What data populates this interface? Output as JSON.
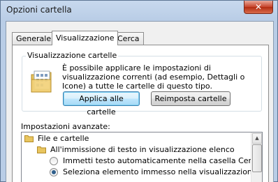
{
  "window": {
    "title": "Opzioni cartella",
    "close_label": "✕"
  },
  "tabs": [
    {
      "label": "Generale",
      "active": false
    },
    {
      "label": "Visualizzazione",
      "active": true
    },
    {
      "label": "Cerca",
      "active": false
    }
  ],
  "folder_view": {
    "group_title": "Visualizzazione cartelle",
    "description": "È possibile applicare le impostazioni di visualizzazione correnti (ad esempio, Dettagli o Icone) a tutte le cartelle di questo tipo.",
    "apply_button": "Applica alle cartelle",
    "reset_button": "Reimposta cartelle"
  },
  "advanced": {
    "label": "Impostazioni avanzate:",
    "items": [
      {
        "label": "File e cartelle",
        "type": "folder",
        "level": 0
      },
      {
        "label": "All'immissione di testo in visualizzazione elenco",
        "type": "folder",
        "level": 1
      },
      {
        "label": "Immetti testo automaticamente nella casella Cerca",
        "type": "radio",
        "checked": false,
        "level": 2
      },
      {
        "label": "Seleziona elemento immesso nella visualizzazione",
        "type": "radio",
        "checked": true,
        "level": 2
      }
    ]
  },
  "colors": {
    "accent": "#3c7fb1",
    "close_button": "#c7432b"
  }
}
